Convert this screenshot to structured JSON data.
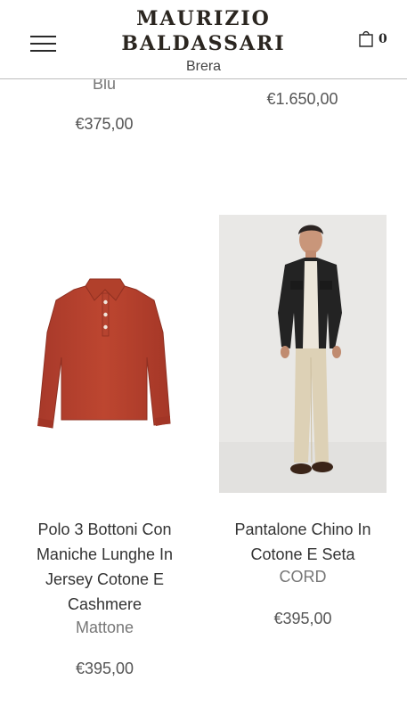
{
  "header": {
    "brand_line1": "MAURIZIO",
    "brand_line2": "BALDASSARI",
    "brand_sub": "Brera",
    "cart_count": "0",
    "menu_icon": "hamburger-menu-icon",
    "cart_icon": "shopping-bag-icon"
  },
  "products": {
    "top_left": {
      "color": "Blu",
      "price": "€375,00"
    },
    "top_right": {
      "price": "€1.650,00"
    },
    "left": {
      "title": "Polo 3 Bottoni Con Maniche Lunghe In Jersey Cotone E Cashmere",
      "color": "Mattone",
      "price": "€395,00",
      "image_color": "#b8412c"
    },
    "right": {
      "title": "Pantalone Chino In Cotone E Seta",
      "color": "CORD",
      "price": "€395,00"
    }
  }
}
